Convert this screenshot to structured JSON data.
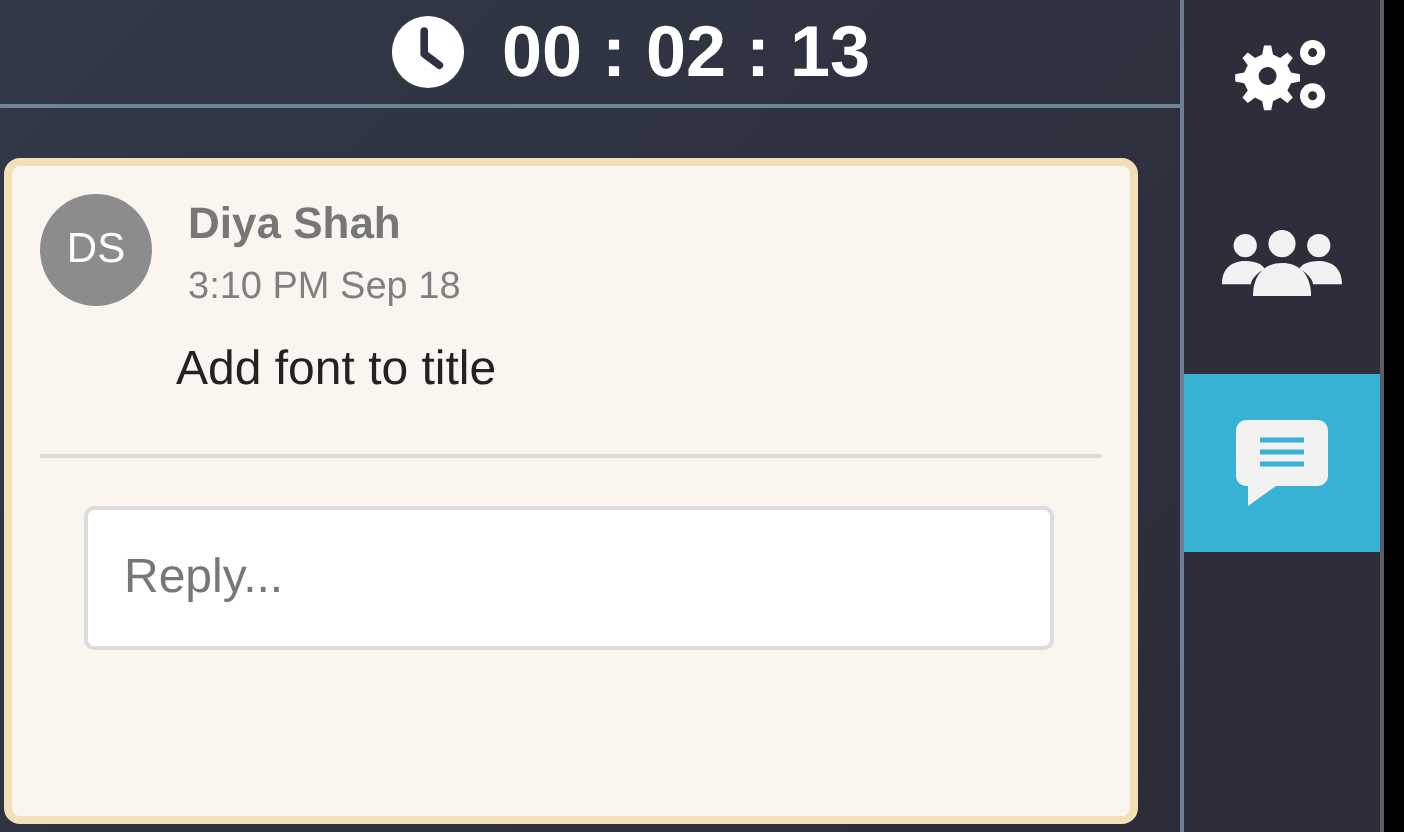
{
  "timer": {
    "time": "00 : 02 : 13"
  },
  "comment": {
    "initials": "DS",
    "author": "Diya Shah",
    "timestamp": "3:10 PM Sep 18",
    "text": "Add font to title"
  },
  "reply": {
    "placeholder": "Reply..."
  },
  "sidebar": {
    "items": [
      {
        "kind": "settings",
        "selected": false
      },
      {
        "kind": "people",
        "selected": false
      },
      {
        "kind": "chat",
        "selected": true
      }
    ]
  }
}
